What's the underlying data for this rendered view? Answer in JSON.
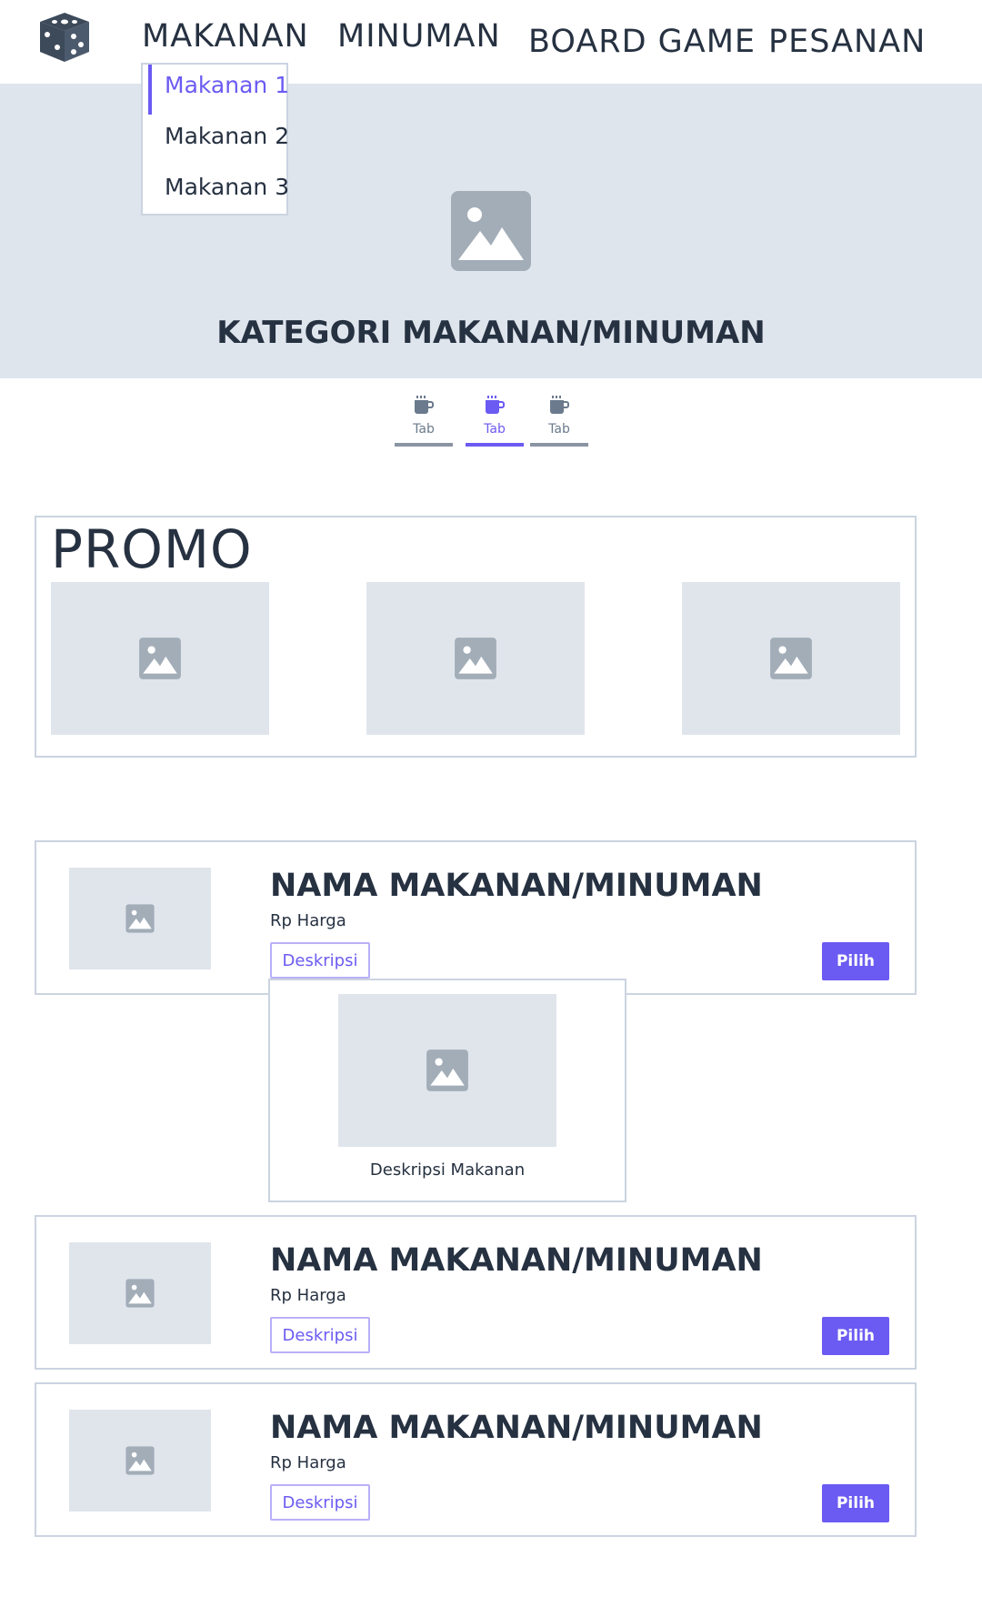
{
  "nav": {
    "items": [
      "MAKANAN",
      "MINUMAN",
      "BOARD GAME",
      "PESANAN"
    ],
    "dropdown": [
      "Makanan 1",
      "Makanan 2",
      "Makanan 3"
    ]
  },
  "hero": {
    "title": "KATEGORI MAKANAN/MINUMAN"
  },
  "tabs": [
    {
      "label": "Tab",
      "active": false
    },
    {
      "label": "Tab",
      "active": true
    },
    {
      "label": "Tab",
      "active": false
    }
  ],
  "promo": {
    "title": "PROMO"
  },
  "products": [
    {
      "name": "NAMA MAKANAN/MINUMAN",
      "price": "Rp Harga",
      "desc_label": "Deskripsi",
      "select_label": "Pilih"
    },
    {
      "name": "NAMA MAKANAN/MINUMAN",
      "price": "Rp Harga",
      "desc_label": "Deskripsi",
      "select_label": "Pilih"
    },
    {
      "name": "NAMA MAKANAN/MINUMAN",
      "price": "Rp Harga",
      "desc_label": "Deskripsi",
      "select_label": "Pilih"
    }
  ],
  "description_popup": {
    "text": "Deskripsi Makanan"
  },
  "colors": {
    "accent": "#6b5bf2",
    "text": "#263141",
    "placeholder": "#dfe5ed",
    "border": "#cbd4e0"
  },
  "icons": [
    "dice-logo-icon",
    "image-placeholder-icon",
    "coffee-cup-icon"
  ]
}
